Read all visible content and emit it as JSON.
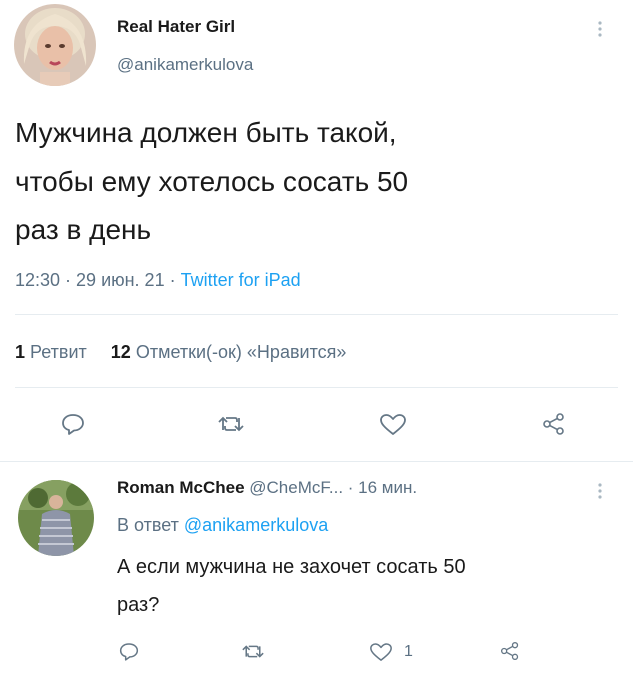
{
  "tweet": {
    "author_name": "Real Hater Girl",
    "author_handle": "@anikamerkulova",
    "text_line1": "Мужчина должен быть такой,",
    "text_line2": "чтобы ему хотелось сосать 50",
    "text_line3": "раз в день",
    "meta": "12:30 · 29 июн. 21 · ",
    "source": "Twitter for iPad",
    "stats": {
      "retweets_count": "1",
      "retweets_label": "Ретвит",
      "likes_count": "12",
      "likes_label": "Отметки(-ок) «Нравится»"
    },
    "actions": [
      "reply-icon",
      "retweet-icon",
      "like-icon",
      "share-icon"
    ]
  },
  "reply": {
    "author_name": "Roman McChee",
    "author_handle": "@CheMcF...",
    "time": "· 16 мин.",
    "reply_to_prefix": "В ответ ",
    "reply_to_handle": "@anikamerkulova",
    "text_line1": "А если мужчина не захочет сосать 50",
    "text_line2": "раз?",
    "like_count": "1",
    "actions": [
      "reply-icon",
      "retweet-icon",
      "like-icon",
      "share-icon"
    ]
  },
  "colors": {
    "link": "#1da1f2",
    "muted": "#5b7083",
    "text": "#1a1a1a"
  }
}
